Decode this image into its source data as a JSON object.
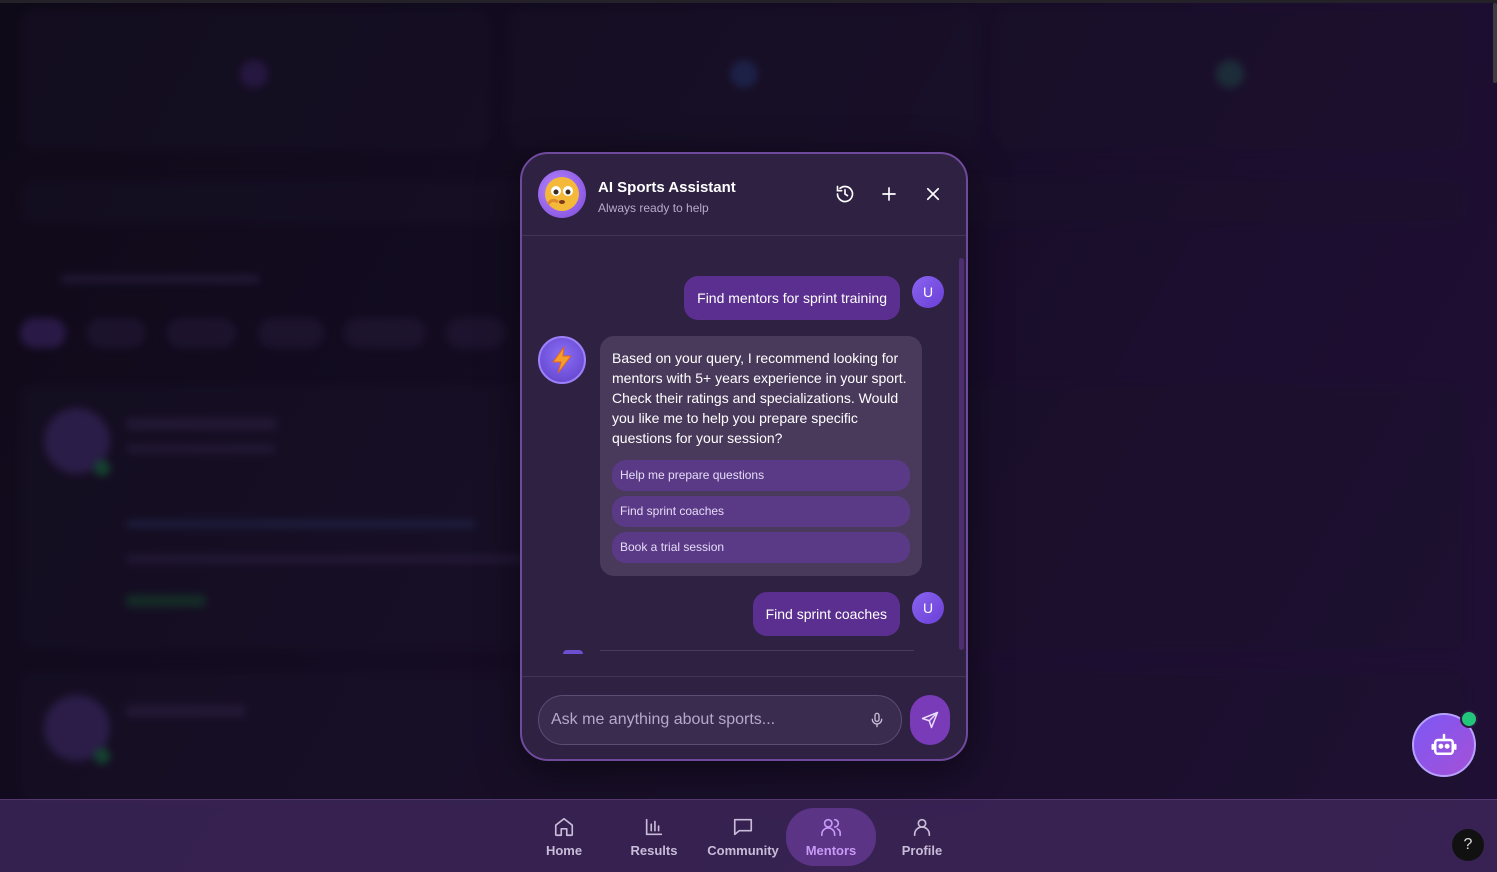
{
  "chat": {
    "title": "AI Sports Assistant",
    "subtitle": "Always ready to help",
    "header_icons": [
      "history-icon",
      "plus-icon",
      "close-icon"
    ],
    "messages": [
      {
        "role": "user",
        "avatar": "U",
        "text": "Find mentors for sprint training"
      },
      {
        "role": "bot",
        "text": "Based on your query, I recommend looking for mentors with 5+ years experience in your sport. Check their ratings and specializations. Would you like me to help you prepare specific questions for your session?",
        "quick_replies": [
          "Help me prepare questions",
          "Find sprint coaches",
          "Book a trial session"
        ]
      },
      {
        "role": "user",
        "avatar": "U",
        "text": "Find sprint coaches"
      }
    ],
    "input": {
      "placeholder": "Ask me anything about sports...",
      "value": ""
    }
  },
  "nav": {
    "items": [
      {
        "label": "Home",
        "icon": "home-icon"
      },
      {
        "label": "Results",
        "icon": "bar-chart-icon"
      },
      {
        "label": "Community",
        "icon": "message-icon"
      },
      {
        "label": "Mentors",
        "icon": "users-icon",
        "active": true
      },
      {
        "label": "Profile",
        "icon": "user-icon"
      }
    ]
  },
  "help": {
    "label": "?"
  },
  "colors": {
    "accent": "#7a3bb8",
    "active_nav": "#c89af7",
    "online": "#22c57a"
  }
}
